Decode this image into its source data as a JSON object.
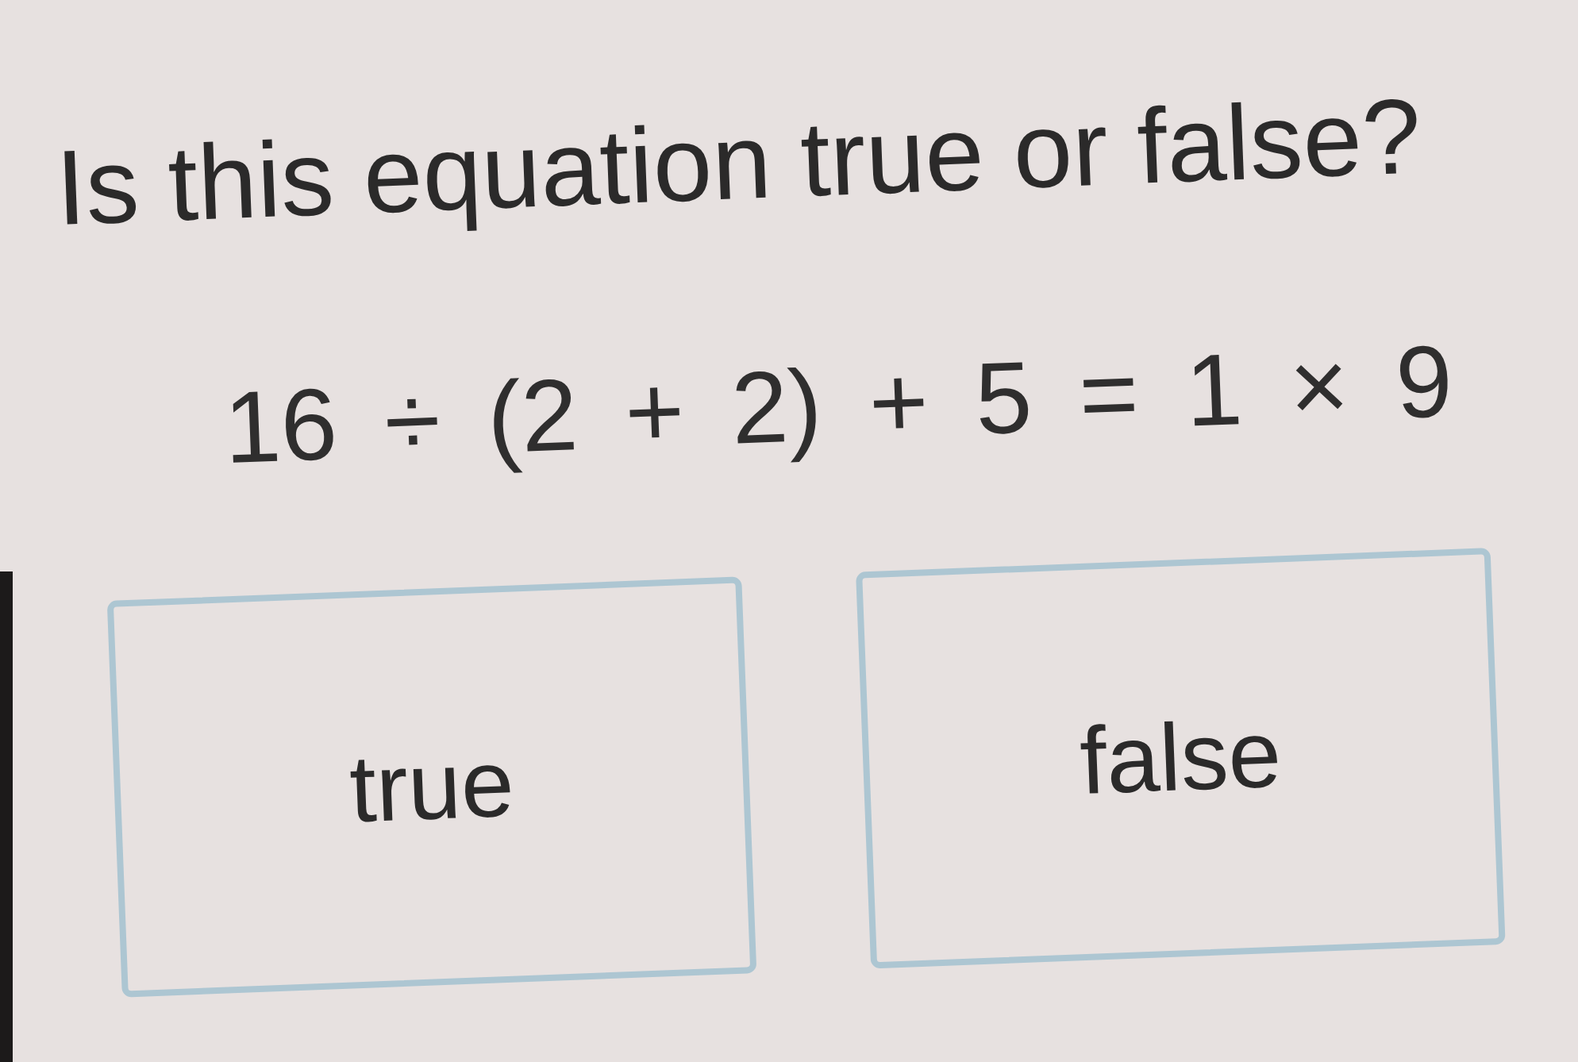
{
  "question": "Is this equation true or false?",
  "equation": "16 ÷ (2 + 2) + 5 = 1 × 9",
  "choices": [
    {
      "label": "true",
      "selected": false
    },
    {
      "label": "false",
      "selected": false
    }
  ]
}
